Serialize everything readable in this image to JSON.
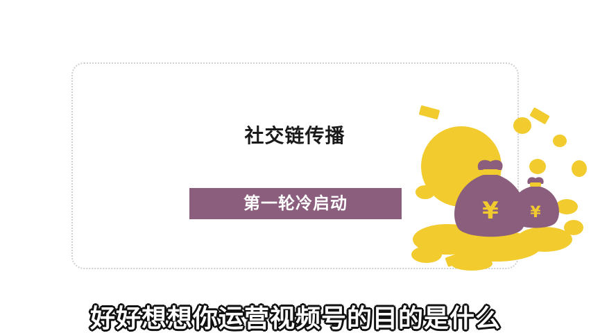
{
  "slide": {
    "title": "社交链传播",
    "banner_label": "第一轮冷启动"
  },
  "illustration": {
    "icon": "money-bags-icon",
    "symbol": "¥",
    "colors": {
      "coin": "#f2cc2e",
      "bag": "#8a5e7c",
      "banner": "#8a5e7c"
    }
  },
  "caption": {
    "text": "好好想想你运营视频号的目的是什么"
  }
}
